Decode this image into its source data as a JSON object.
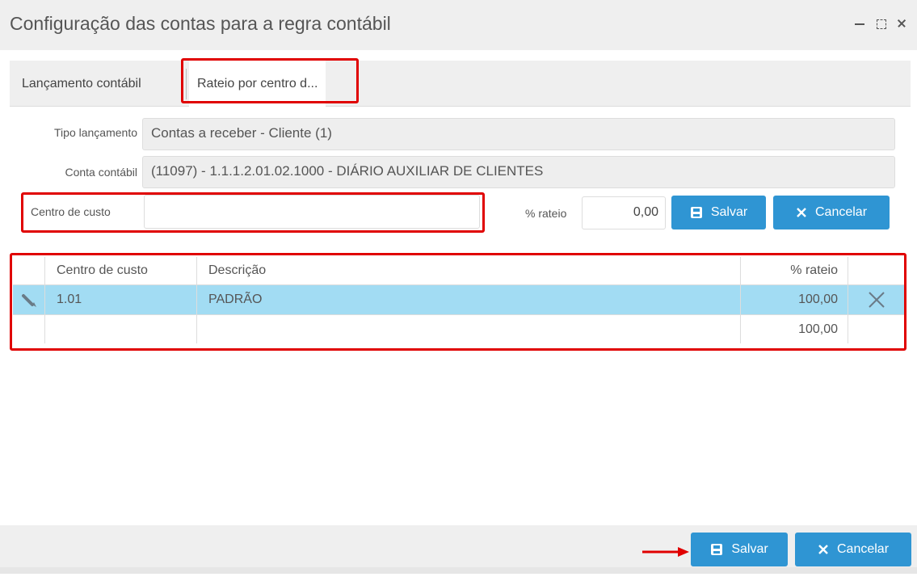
{
  "window": {
    "title": "Configuração das contas para a regra contábil"
  },
  "tabs": [
    {
      "label": "Lançamento contábil"
    },
    {
      "label": "Rateio por centro d..."
    }
  ],
  "form": {
    "tipo_label": "Tipo lançamento",
    "tipo_value": "Contas a receber - Cliente (1)",
    "conta_label": "Conta contábil",
    "conta_value": "(11097) - 1.1.1.2.01.02.1000 - DIÁRIO AUXILIAR DE CLIENTES",
    "centro_label": "Centro de custo",
    "centro_value": "",
    "rateio_label": "% rateio",
    "rateio_value": "0,00",
    "save_label": "Salvar",
    "cancel_label": "Cancelar"
  },
  "grid": {
    "columns": [
      "Centro de custo",
      "Descrição",
      "% rateio"
    ],
    "rows": [
      {
        "centro": "1.01",
        "descricao": "PADRÃO",
        "rateio": "100,00"
      }
    ],
    "total": "100,00"
  },
  "footer": {
    "save_label": "Salvar",
    "cancel_label": "Cancelar"
  },
  "colors": {
    "accent": "#2f95d3",
    "highlight": "#e00000",
    "selected_row": "#a2dcf3"
  },
  "icons": [
    "minimize-icon",
    "maximize-icon",
    "close-icon",
    "search-icon",
    "chevron-down-icon",
    "save-icon",
    "cancel-x-icon",
    "pencil-icon",
    "delete-icon",
    "arrow-icon"
  ]
}
